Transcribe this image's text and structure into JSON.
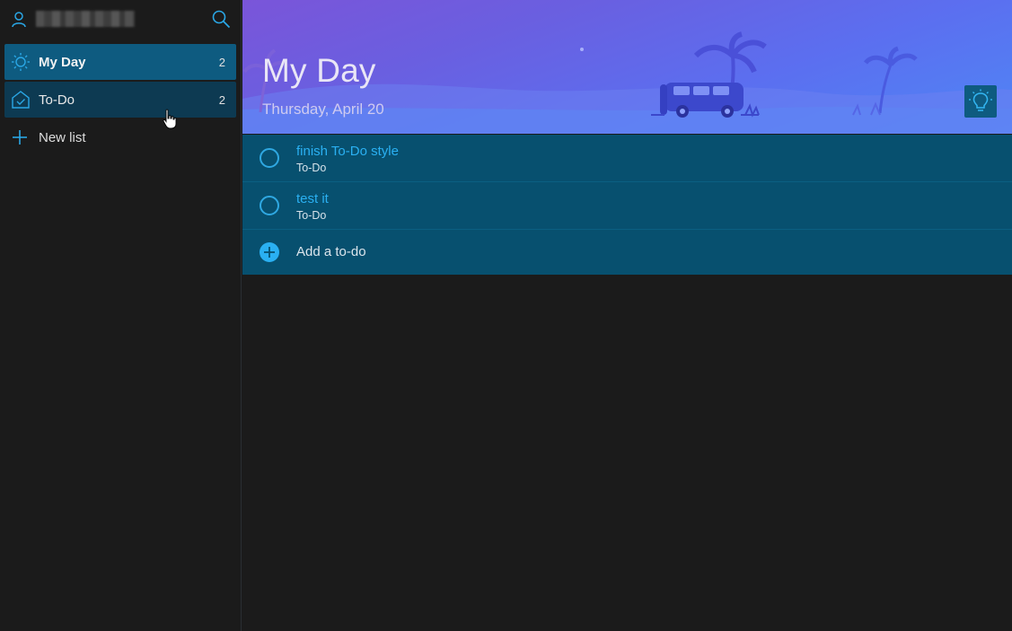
{
  "sidebar": {
    "items": [
      {
        "label": "My Day",
        "count": "2",
        "icon": "sun-icon"
      },
      {
        "label": "To-Do",
        "count": "2",
        "icon": "home-check-icon"
      }
    ],
    "new_list_label": "New list"
  },
  "main": {
    "title": "My Day",
    "date": "Thursday, April 20",
    "tasks": [
      {
        "title": "finish To-Do style",
        "list": "To-Do"
      },
      {
        "title": "test it",
        "list": "To-Do"
      }
    ],
    "add_label": "Add a to-do"
  },
  "colors": {
    "accent": "#2ab0f2",
    "selected_nav": "#0e5b80",
    "task_bg": "#07506f",
    "background": "#1b1b1b"
  }
}
